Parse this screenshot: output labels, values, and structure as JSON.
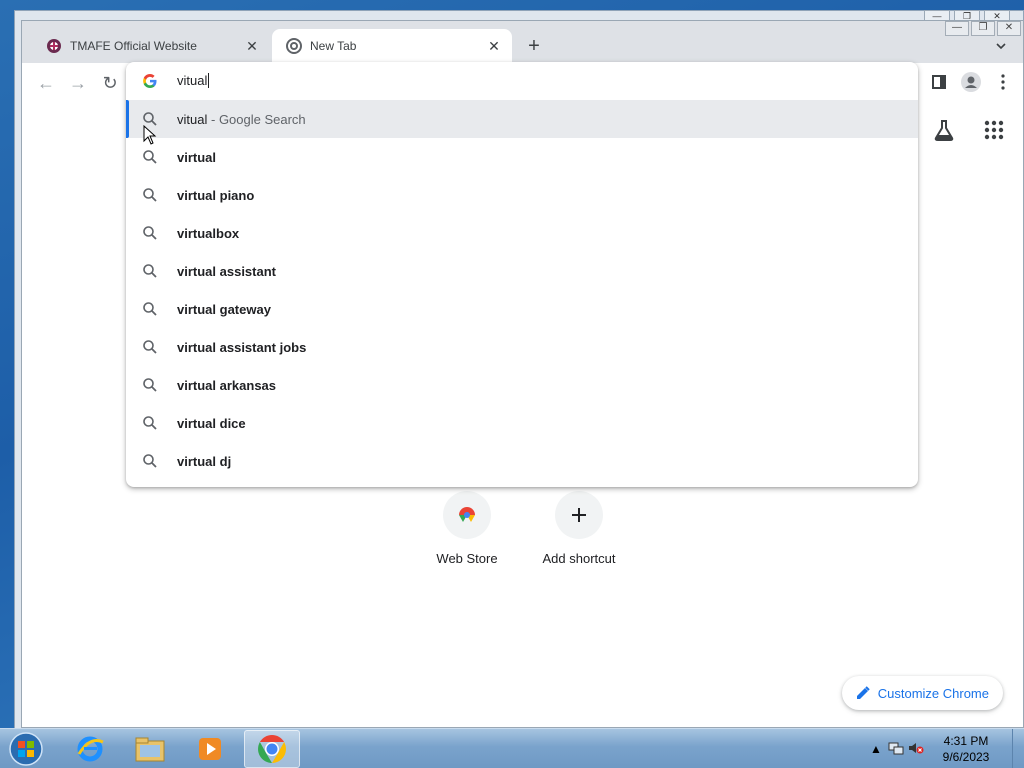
{
  "browser": {
    "tabs": [
      {
        "title": "TMAFE Official Website",
        "active": false
      },
      {
        "title": "New Tab",
        "active": true
      }
    ],
    "window_controls": [
      "—",
      "❐",
      "✕"
    ]
  },
  "omnibox": {
    "typed_text": "vitual",
    "suggestions": [
      {
        "text": "vitual",
        "suffix": "Google Search",
        "selected": true
      },
      {
        "text": "virtual"
      },
      {
        "text": "virtual piano"
      },
      {
        "text": "virtualbox"
      },
      {
        "text": "virtual assistant"
      },
      {
        "text": "virtual gateway"
      },
      {
        "text": "virtual assistant jobs"
      },
      {
        "text": "virtual arkansas"
      },
      {
        "text": "virtual dice"
      },
      {
        "text": "virtual dj"
      }
    ]
  },
  "ntp": {
    "shortcuts": [
      {
        "label": "Web Store"
      },
      {
        "label": "Add shortcut"
      }
    ],
    "customize_label": "Customize Chrome"
  },
  "taskbar": {
    "time": "4:31 PM",
    "date": "9/6/2023"
  },
  "colors": {
    "accent": "#1a73e8",
    "tabstrip": "#dee1e6",
    "selected_row": "#e8eaed"
  }
}
